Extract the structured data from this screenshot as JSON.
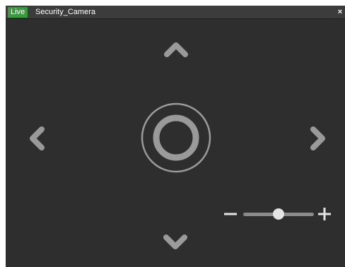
{
  "titlebar": {
    "live_label": "Live",
    "camera_name": "Security_Camera",
    "close_glyph": "×"
  },
  "ptz_controls": {
    "up": "chevron-up-icon",
    "down": "chevron-down-icon",
    "left": "chevron-left-icon",
    "right": "chevron-right-icon",
    "center": "home-ring-icon"
  },
  "zoom": {
    "minus_icon": "minus-icon",
    "plus_icon": "plus-icon",
    "level": 0.5
  },
  "colors": {
    "background": "#2e2e2e",
    "titlebar": "#3c3c3c",
    "live_badge": "#3b9a3f",
    "control": "#9a9a9a",
    "zoom_thumb": "#e4e4e4"
  }
}
